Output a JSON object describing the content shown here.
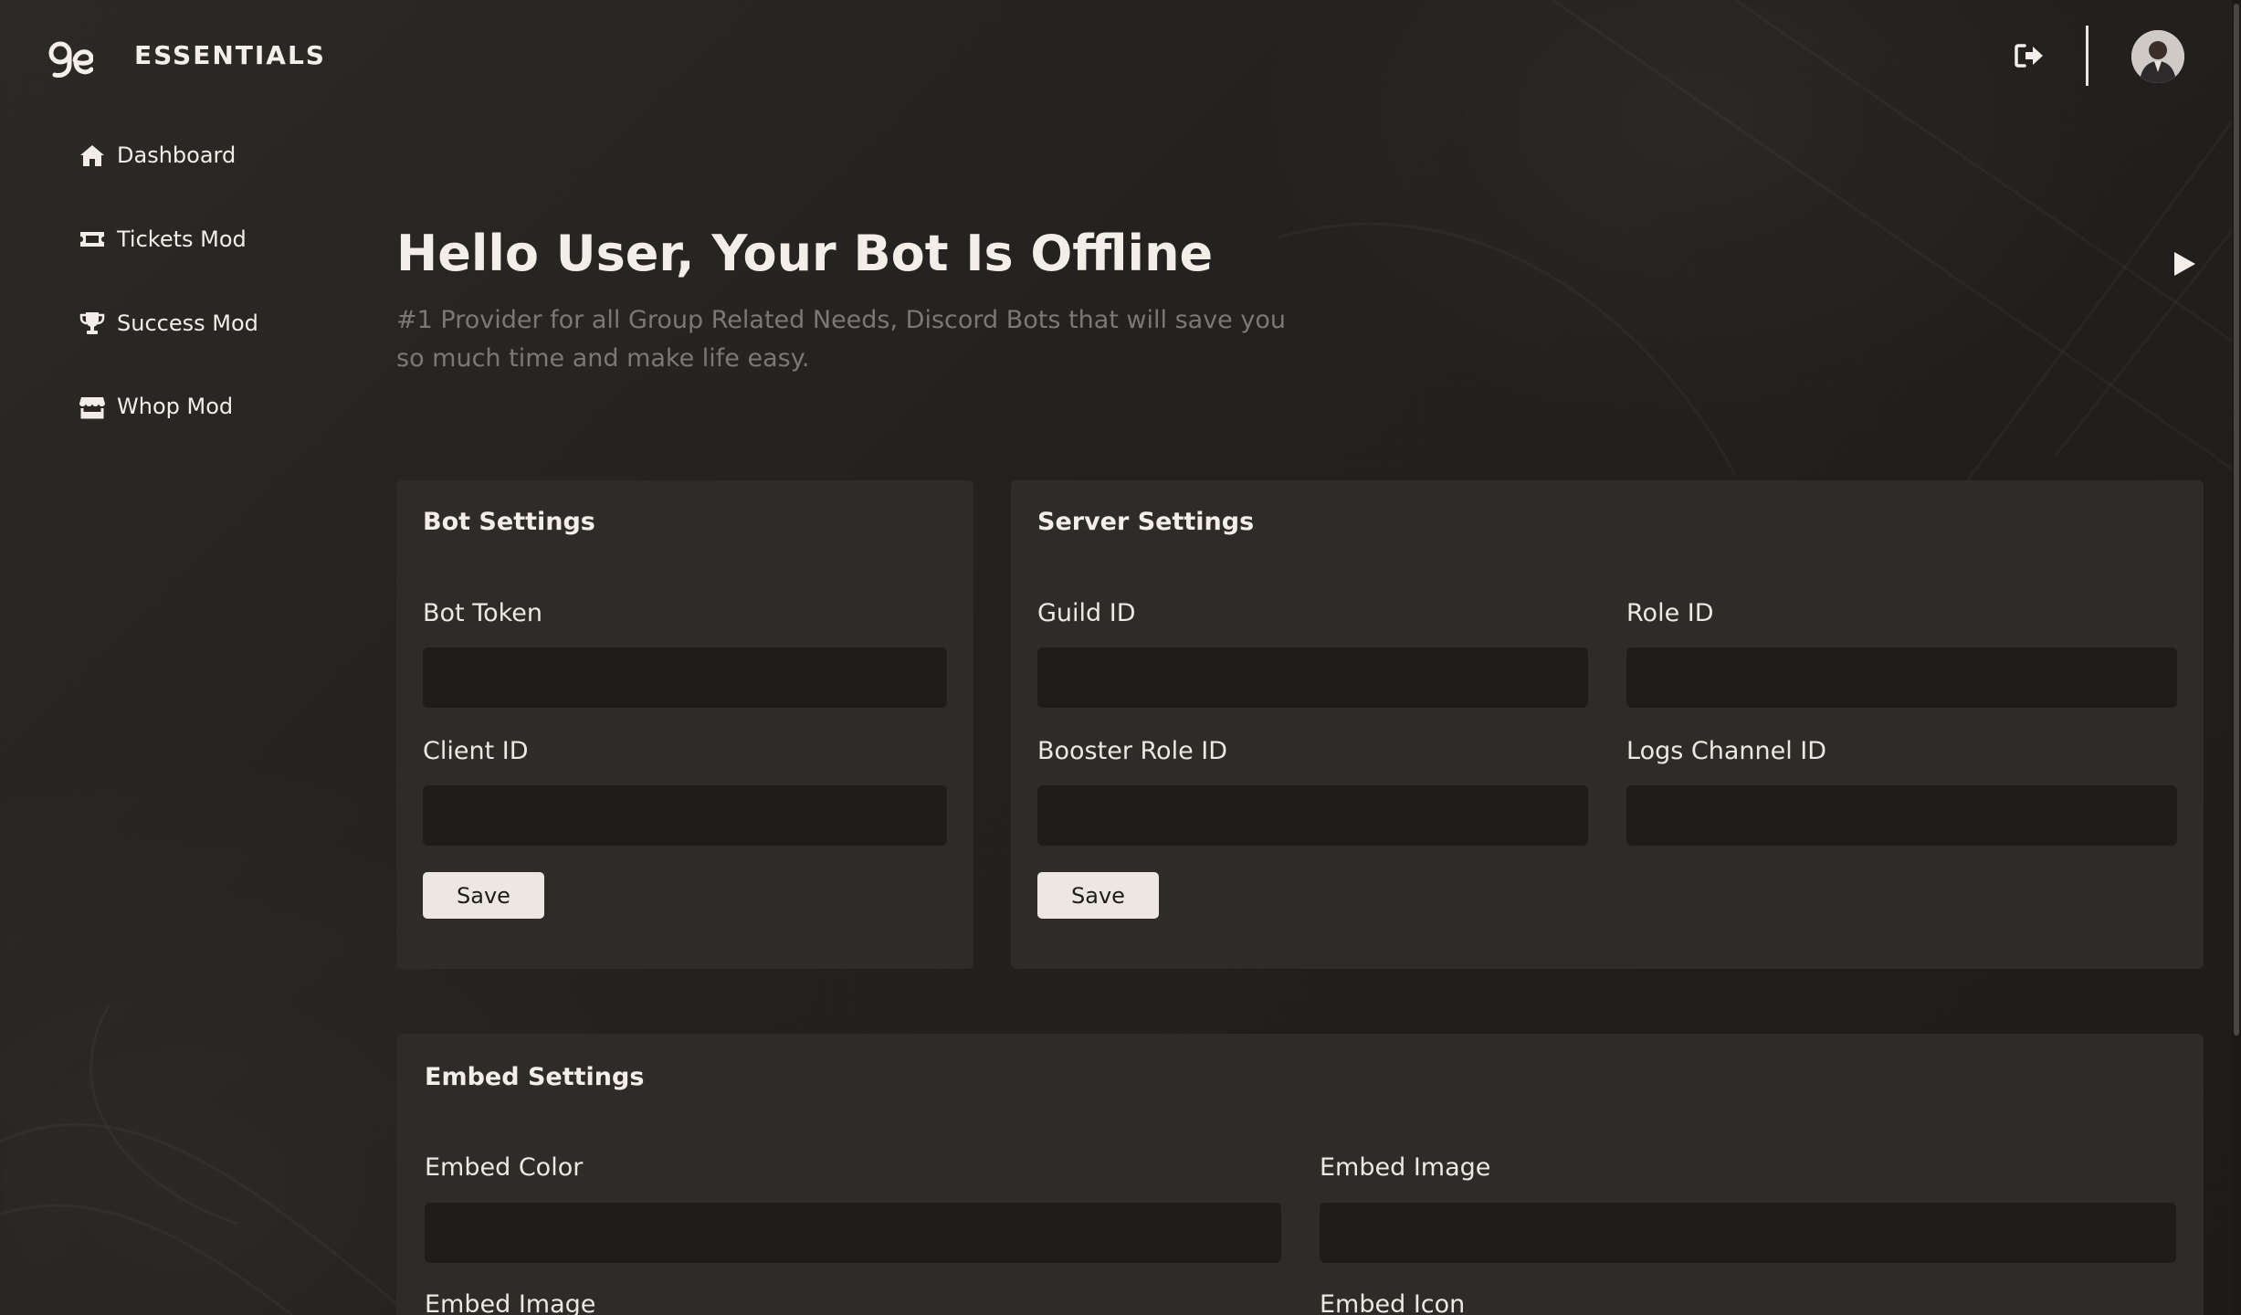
{
  "brand": {
    "name": "ESSENTIALS"
  },
  "header": {
    "logout_icon": "sign-out-icon",
    "avatar_icon": "user-avatar"
  },
  "sidebar": {
    "items": [
      {
        "label": "Dashboard",
        "icon": "home-icon"
      },
      {
        "label": "Tickets Mod",
        "icon": "ticket-icon"
      },
      {
        "label": "Success Mod",
        "icon": "trophy-icon"
      },
      {
        "label": "Whop Mod",
        "icon": "store-icon"
      }
    ]
  },
  "hero": {
    "title": "Hello User, Your Bot Is Offline",
    "subtitle": "#1 Provider for all Group Related Needs, Discord Bots that will save you so much time and make life easy.",
    "play_icon": "play-icon"
  },
  "bot_settings": {
    "title": "Bot Settings",
    "fields": [
      {
        "label": "Bot Token",
        "value": ""
      },
      {
        "label": "Client ID",
        "value": ""
      }
    ],
    "save_label": "Save"
  },
  "server_settings": {
    "title": "Server Settings",
    "fields": [
      {
        "label": "Guild ID",
        "value": ""
      },
      {
        "label": "Role ID",
        "value": ""
      },
      {
        "label": "Booster Role ID",
        "value": ""
      },
      {
        "label": "Logs Channel ID",
        "value": ""
      }
    ],
    "save_label": "Save"
  },
  "embed_settings": {
    "title": "Embed Settings",
    "fields": [
      {
        "label": "Embed Color",
        "value": ""
      },
      {
        "label": "Embed Image",
        "value": ""
      },
      {
        "label": "Embed Image",
        "value": ""
      },
      {
        "label": "Embed Icon",
        "value": ""
      }
    ]
  },
  "colors": {
    "background": "#242120",
    "card": "#2f2b28",
    "input": "#1f1c1b",
    "button": "#ece7e1",
    "muted_text": "#7d7874"
  }
}
